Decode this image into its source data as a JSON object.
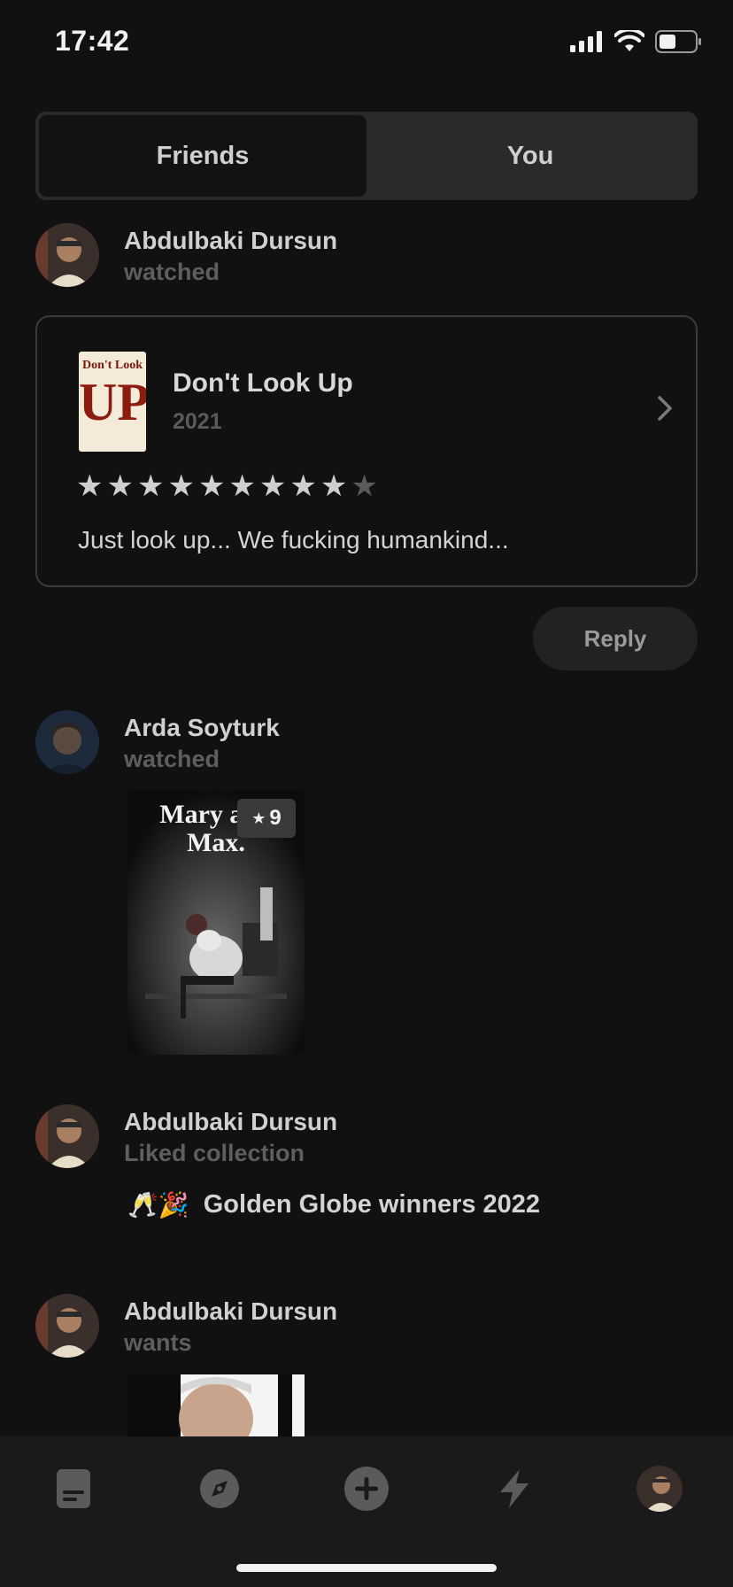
{
  "status_bar": {
    "time": "17:42"
  },
  "segment": {
    "friends_label": "Friends",
    "you_label": "You",
    "active": "Friends"
  },
  "feed": [
    {
      "user": "Abdulbaki Dursun",
      "action": "watched",
      "movie_title": "Don't Look Up",
      "movie_year": "2021",
      "poster_text_top": "Don't Look",
      "poster_text_big": "UP",
      "rating_out_of_10": 9,
      "review": "Just look up... We fucking humankind...",
      "reply_label": "Reply"
    },
    {
      "user": "Arda Soyturk",
      "action": "watched",
      "poster_text": "Mary and Max.",
      "rating_badge": "9"
    },
    {
      "user": "Abdulbaki Dursun",
      "action": "Liked collection",
      "collection_emoji": "🥂🎉",
      "collection_title": "Golden Globe winners 2022"
    },
    {
      "user": "Abdulbaki Dursun",
      "action": "wants"
    }
  ],
  "tabbar": {
    "items": [
      "feed-icon",
      "explore-icon",
      "add-icon",
      "activity-icon",
      "profile-avatar"
    ]
  },
  "colors": {
    "background": "#111111",
    "card_border": "#3a3a3a",
    "muted": "#5e5e5e"
  }
}
